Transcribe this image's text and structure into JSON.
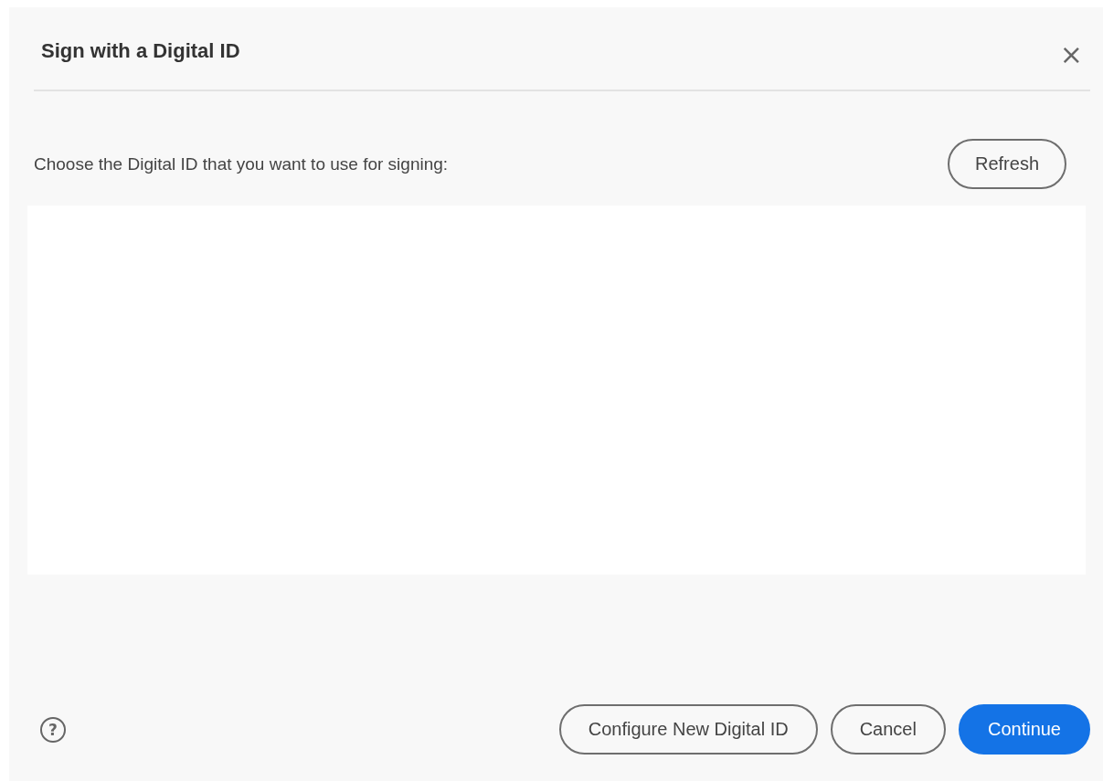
{
  "dialog": {
    "title": "Sign with a Digital ID",
    "close": "×"
  },
  "prompt": "Choose the Digital ID that you want to use for signing:",
  "refresh_button": "Refresh",
  "footer": {
    "help": "?",
    "buttons": [
      {
        "label": "Configure New Digital ID",
        "kind": "secondary"
      },
      {
        "label": "Cancel",
        "kind": "secondary"
      },
      {
        "label": "Continue",
        "kind": "primary"
      }
    ]
  }
}
